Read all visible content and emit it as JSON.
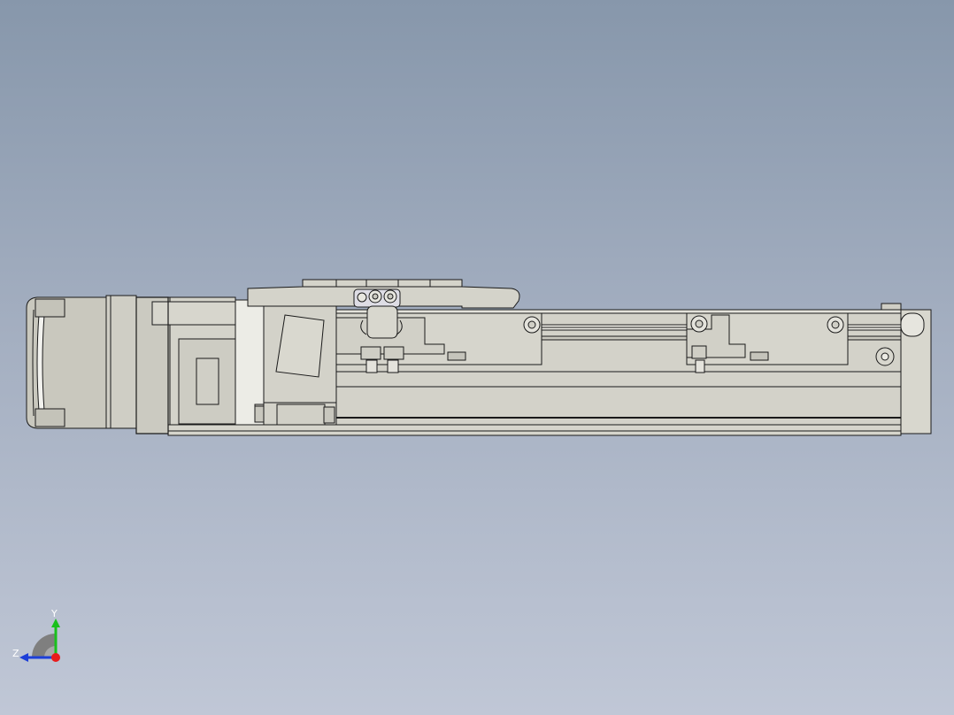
{
  "viewport": {
    "background_top": "#8797ab",
    "background_bottom": "#c0c7d6",
    "part_color": "#d2d1c8",
    "part_shade": "#bfbeb4",
    "edge_color": "#1a1a1a"
  },
  "model": {
    "name_icon": "linear-actuator-model"
  },
  "triad": {
    "y_label": "Y",
    "z_label": "Z",
    "y_color": "#19c01c",
    "z_color": "#1d3fd8",
    "x_color": "#e81c1c"
  }
}
